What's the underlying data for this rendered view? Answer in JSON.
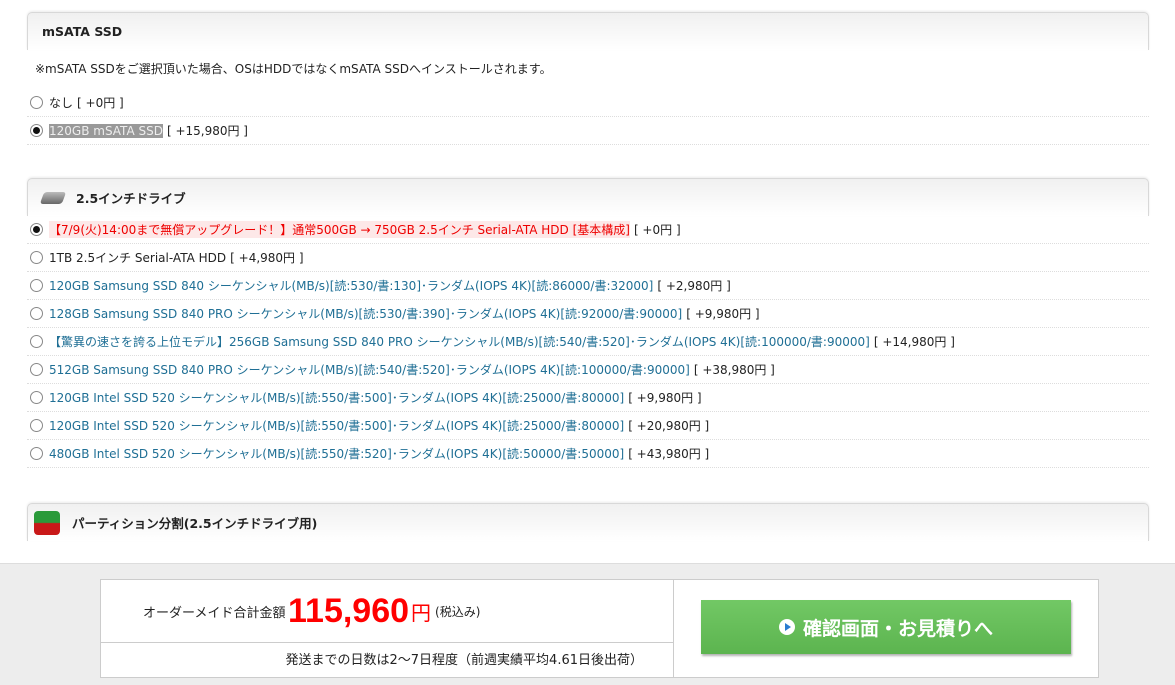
{
  "msata": {
    "title": "mSATA SSD",
    "note": "※mSATA SSDをご選択頂いた場合、OSはHDDではなくmSATA SSDへインストールされます。",
    "options": [
      {
        "label": "なし",
        "price": "[ +0円 ]",
        "selected": false
      },
      {
        "label": "120GB mSATA SSD",
        "price": "[ +15,980円 ]",
        "selected": true
      }
    ]
  },
  "drive25": {
    "title": "2.5インチドライブ",
    "icon": "hdd-icon",
    "options": [
      {
        "label": "【7/9(火)14:00まで無償アップグレード！】通常500GB → 750GB 2.5インチ Serial-ATA HDD [基本構成]",
        "price": "[ +0円 ]",
        "selected": true,
        "style": "red"
      },
      {
        "label": "1TB 2.5インチ Serial-ATA HDD",
        "price": "[ +4,980円 ]",
        "selected": false,
        "style": "plain"
      },
      {
        "label": "120GB Samsung SSD 840 シーケンシャル(MB/s)[読:530/書:130]･ランダム(IOPS 4K)[読:86000/書:32000]",
        "price": "[ +2,980円 ]",
        "selected": false,
        "style": "blue"
      },
      {
        "label": "128GB Samsung SSD 840 PRO シーケンシャル(MB/s)[読:530/書:390]･ランダム(IOPS 4K)[読:92000/書:90000]",
        "price": "[ +9,980円 ]",
        "selected": false,
        "style": "blue"
      },
      {
        "label": "【驚異の速さを誇る上位モデル】256GB Samsung SSD 840 PRO シーケンシャル(MB/s)[読:540/書:520]･ランダム(IOPS 4K)[読:100000/書:90000]",
        "price": "[ +14,980円 ]",
        "selected": false,
        "style": "blue"
      },
      {
        "label": "512GB Samsung SSD 840 PRO シーケンシャル(MB/s)[読:540/書:520]･ランダム(IOPS 4K)[読:100000/書:90000]",
        "price": "[ +38,980円 ]",
        "selected": false,
        "style": "blue"
      },
      {
        "label": "120GB Intel SSD 520 シーケンシャル(MB/s)[読:550/書:500]･ランダム(IOPS 4K)[読:25000/書:80000]",
        "price": "[ +9,980円 ]",
        "selected": false,
        "style": "blue"
      },
      {
        "label": "120GB Intel SSD 520 シーケンシャル(MB/s)[読:550/書:500]･ランダム(IOPS 4K)[読:25000/書:80000]",
        "price": "[ +20,980円 ]",
        "selected": false,
        "style": "blue"
      },
      {
        "label": "480GB Intel SSD 520 シーケンシャル(MB/s)[読:550/書:520]･ランダム(IOPS 4K)[読:50000/書:50000]",
        "price": "[ +43,980円 ]",
        "selected": false,
        "style": "blue"
      }
    ]
  },
  "partition": {
    "title": "パーティション分割(2.5インチドライブ用)",
    "icon": "partition-icon"
  },
  "footer": {
    "total_label": "オーダーメイド合計金額",
    "total_amount": "115,960",
    "yen": "円",
    "tax": "(税込み)",
    "shipping": "発送までの日数は2～7日程度（前週実績平均4.61日後出荷）",
    "confirm_button": "確認画面・お見積りへ"
  },
  "colors": {
    "price_red": "#ff0000",
    "button_green": "#66bb5a",
    "link_blue": "#1f6f95"
  }
}
